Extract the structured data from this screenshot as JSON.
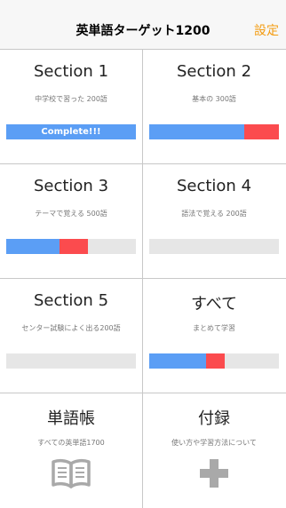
{
  "header": {
    "title": "英単語ターゲット1200",
    "settings_label": "設定"
  },
  "colors": {
    "progress_blue": "#5b9ef5",
    "progress_red": "#fb4b4e",
    "track": "#e6e6e6",
    "accent": "#f39c12"
  },
  "cells": [
    {
      "title": "Section 1",
      "subtitle": "中学校で習った 200語",
      "progress_done": 1.0,
      "progress_review": 0.0,
      "complete_label": "Complete!!!"
    },
    {
      "title": "Section 2",
      "subtitle": "基本の 300語",
      "progress_done": 0.73,
      "progress_review": 0.27
    },
    {
      "title": "Section 3",
      "subtitle": "テーマで覚える 500語",
      "progress_done": 0.41,
      "progress_review": 0.22
    },
    {
      "title": "Section 4",
      "subtitle": "語法で覚える 200語",
      "progress_done": 0.0,
      "progress_review": 0.0
    },
    {
      "title": "Section 5",
      "subtitle": "センター試験によく出る200語",
      "progress_done": 0.0,
      "progress_review": 0.0
    },
    {
      "title": "すべて",
      "subtitle": "まとめて学習",
      "progress_done": 0.44,
      "progress_review": 0.14
    },
    {
      "title": "単語帳",
      "subtitle": "すべての英単語1700",
      "icon": "open-book-icon"
    },
    {
      "title": "付録",
      "subtitle": "使い方や学習方法について",
      "icon": "plus-icon"
    }
  ]
}
